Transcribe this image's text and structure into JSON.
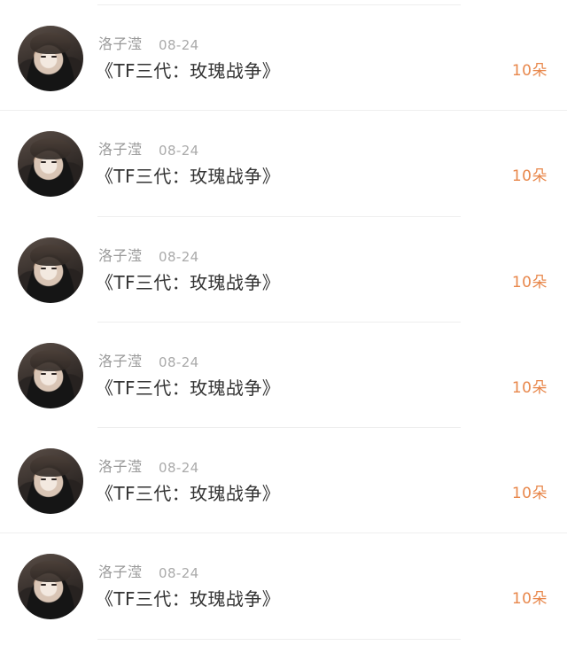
{
  "gift_list": {
    "items": [
      {
        "user": "洛子滢",
        "date": "08-24",
        "title": "《TF三代：玫瑰战争》",
        "count": "10朵"
      },
      {
        "user": "洛子滢",
        "date": "08-24",
        "title": "《TF三代：玫瑰战争》",
        "count": "10朵"
      },
      {
        "user": "洛子滢",
        "date": "08-24",
        "title": "《TF三代：玫瑰战争》",
        "count": "10朵"
      },
      {
        "user": "洛子滢",
        "date": "08-24",
        "title": "《TF三代：玫瑰战争》",
        "count": "10朵"
      },
      {
        "user": "洛子滢",
        "date": "08-24",
        "title": "《TF三代：玫瑰战争》",
        "count": "10朵"
      },
      {
        "user": "洛子滢",
        "date": "08-24",
        "title": "《TF三代：玫瑰战争》",
        "count": "10朵"
      }
    ]
  },
  "colors": {
    "accent": "#E8874B",
    "name_text": "#999999",
    "title_text": "#333333",
    "divider": "#EEEEEE"
  },
  "icons": {
    "avatar": "user-avatar-photo"
  }
}
